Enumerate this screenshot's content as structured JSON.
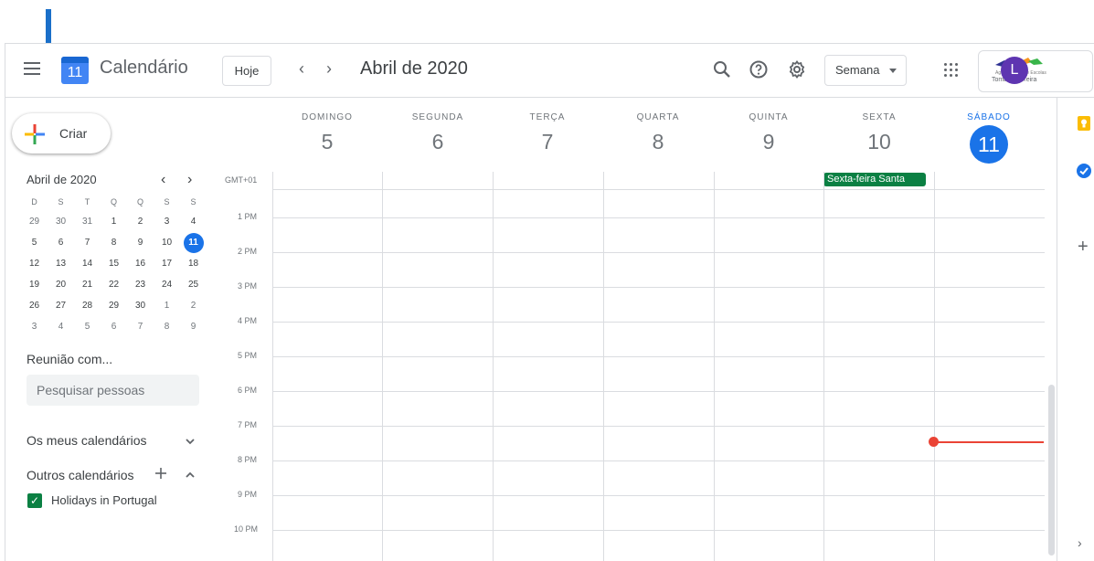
{
  "header": {
    "app_title": "Calendário",
    "logo_day": "11",
    "today_label": "Hoje",
    "prev_icon": "‹",
    "next_icon": "›",
    "period": "Abril de 2020",
    "view_label": "Semana",
    "avatar_letter": "L",
    "school_line1": "Agrupamento de Escolas",
    "school_line2": "Tomás Cabreira"
  },
  "sidebar": {
    "create_label": "Criar",
    "mini_title": "Abril de 2020",
    "weekdays": [
      "D",
      "S",
      "T",
      "Q",
      "Q",
      "S",
      "S"
    ],
    "weeks": [
      [
        "29",
        "30",
        "31",
        "1",
        "2",
        "3",
        "4"
      ],
      [
        "5",
        "6",
        "7",
        "8",
        "9",
        "10",
        "11"
      ],
      [
        "12",
        "13",
        "14",
        "15",
        "16",
        "17",
        "18"
      ],
      [
        "19",
        "20",
        "21",
        "22",
        "23",
        "24",
        "25"
      ],
      [
        "26",
        "27",
        "28",
        "29",
        "30",
        "1",
        "2"
      ],
      [
        "3",
        "4",
        "5",
        "6",
        "7",
        "8",
        "9"
      ]
    ],
    "meet_title": "Reunião com...",
    "search_placeholder": "Pesquisar pessoas",
    "my_calendars": "Os meus calendários",
    "other_calendars": "Outros calendários",
    "calendar_item": "Holidays in Portugal"
  },
  "week": {
    "days": [
      {
        "name": "DOMINGO",
        "num": "5"
      },
      {
        "name": "SEGUNDA",
        "num": "6"
      },
      {
        "name": "TERÇA",
        "num": "7"
      },
      {
        "name": "QUARTA",
        "num": "8"
      },
      {
        "name": "QUINTA",
        "num": "9"
      },
      {
        "name": "SEXTA",
        "num": "10"
      },
      {
        "name": "SÁBADO",
        "num": "11"
      }
    ],
    "timezone": "GMT+01",
    "all_day_event": "Sexta-feira Santa",
    "times": [
      "1 PM",
      "2 PM",
      "3 PM",
      "4 PM",
      "5 PM",
      "6 PM",
      "7 PM",
      "8 PM",
      "9 PM",
      "10 PM"
    ]
  },
  "colors": {
    "accent": "#1a73e8",
    "event": "#0b8043",
    "now_line": "#ea4335",
    "arrow": "#1a6fc9"
  }
}
